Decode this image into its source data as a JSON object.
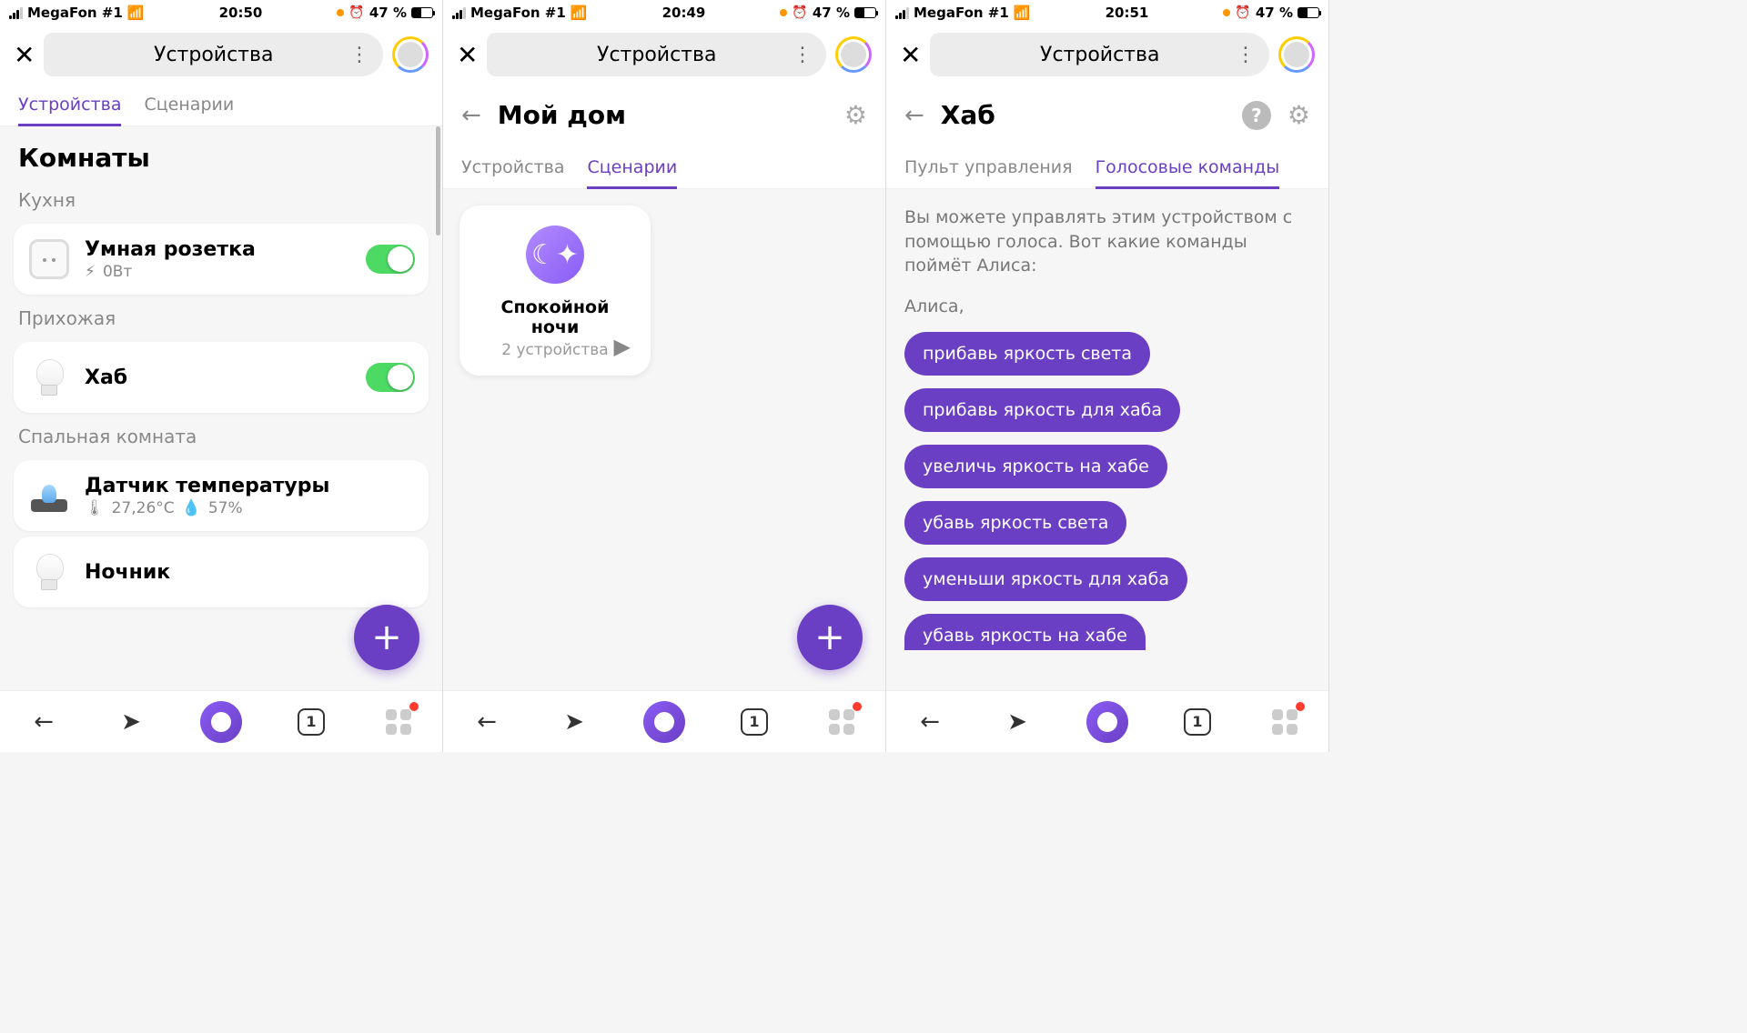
{
  "status": {
    "carrier": "MegaFon #1",
    "battery_pct": "47 %"
  },
  "times": [
    "20:50",
    "20:49",
    "20:51"
  ],
  "header_title": "Устройства",
  "phone1": {
    "tabs": [
      "Устройства",
      "Сценарии"
    ],
    "rooms_title": "Комнаты",
    "rooms": [
      {
        "name": "Кухня",
        "devices": [
          {
            "name": "Умная розетка",
            "meta": "0Вт",
            "toggle": true,
            "icon": "socket"
          }
        ]
      },
      {
        "name": "Прихожая",
        "devices": [
          {
            "name": "Хаб",
            "toggle": true,
            "icon": "bulb"
          }
        ]
      },
      {
        "name": "Спальная комната",
        "devices": [
          {
            "name": "Датчик температуры",
            "temp": "27,26°C",
            "hum": "57%",
            "icon": "sensor"
          },
          {
            "name": "Ночник",
            "icon": "bulb"
          }
        ]
      }
    ]
  },
  "phone2": {
    "page_title": "Мой дом",
    "tabs": [
      "Устройства",
      "Сценарии"
    ],
    "scenario": {
      "name": "Спокойной ночи",
      "sub": "2 устройства"
    }
  },
  "phone3": {
    "page_title": "Хаб",
    "tabs": [
      "Пульт управления",
      "Голосовые команды"
    ],
    "intro": "Вы можете управлять этим устройством с помощью голоса. Вот какие команды поймёт Алиса:",
    "prompt": "Алиса,",
    "commands": [
      "прибавь яркость света",
      "прибавь яркость для хаба",
      "увеличь яркость на хабе",
      "убавь яркость света",
      "уменьши яркость для хаба",
      "убавь яркость на хабе"
    ]
  },
  "nav": {
    "tab_count": "1"
  }
}
